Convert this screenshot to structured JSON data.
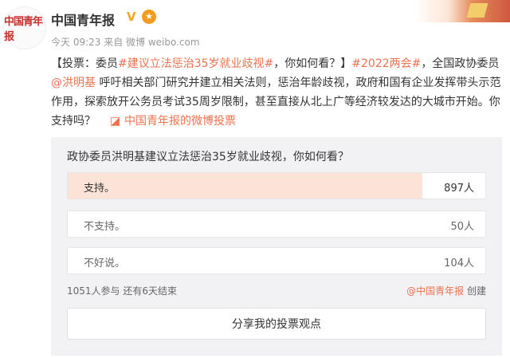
{
  "account": {
    "name": "中国青年报",
    "avatar_text": "中国青年报",
    "verified_icon": "verified-v-icon",
    "medal_icon": "medal-icon"
  },
  "post_meta": {
    "time": "今天 09:23",
    "source": "来自 微博 weibo.com"
  },
  "post": {
    "prefix": "【投票：委员",
    "topic1": "#建议立法惩治35岁就业歧视#",
    "mid1": "，你如何看？】",
    "topic2": "#2022两会#",
    "mid2": "，全国政协委员",
    "mention": "@洪明基",
    "body": " 呼吁相关部门研究并建立相关法则，惩治年龄歧视，政府和国有企业发挥带头示范作用，探索放开公务员考试35周岁限制，甚至直接从北上广等经济较发达的大城市开始。你支持吗？",
    "vote_link_icon": "poll-icon",
    "vote_link": "中国青年报的微博投票"
  },
  "poll": {
    "question": "政协委员洪明基建议立法惩治35岁就业歧视，你如何看？",
    "options": [
      {
        "label": "支持。",
        "count": "897人",
        "fraction": 0.85
      },
      {
        "label": "不支持。",
        "count": "50人",
        "fraction": 0.0
      },
      {
        "label": "不好说。",
        "count": "104人",
        "fraction": 0.0
      }
    ],
    "summary": "1051人参与  还有6天结束",
    "creator": "@中国青年报",
    "creator_suffix": "创建",
    "share_button": "分享我的投票观点"
  },
  "colors": {
    "accent": "#eb7350",
    "selected_fill": "#fbe3d7",
    "card_bg": "#f2f2f5"
  }
}
